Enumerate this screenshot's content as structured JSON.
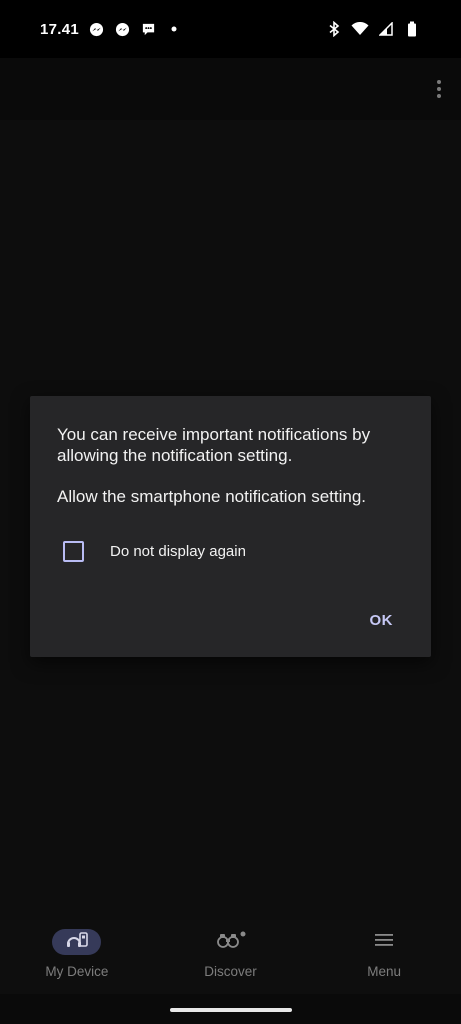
{
  "status_bar": {
    "time": "17.41",
    "left_icons": [
      "messenger-icon",
      "messenger-icon",
      "chat-bubble-icon",
      "dot-icon"
    ],
    "right_icons": [
      "bluetooth-icon",
      "wifi-icon",
      "cell-signal-icon",
      "battery-icon"
    ]
  },
  "dialog": {
    "message": "You can receive important notifications by allowing the notification setting.",
    "message2": "Allow the smartphone notification setting.",
    "checkbox_label": "Do not display again",
    "checkbox_checked": false,
    "ok_label": "OK",
    "accent_color": "#c6c8f5"
  },
  "bottom_nav": {
    "items": [
      {
        "label": "My Device",
        "icon": "my-device-icon",
        "active": true
      },
      {
        "label": "Discover",
        "icon": "binoculars-icon",
        "active": false,
        "badge": true
      },
      {
        "label": "Menu",
        "icon": "menu-icon",
        "active": false
      }
    ]
  }
}
